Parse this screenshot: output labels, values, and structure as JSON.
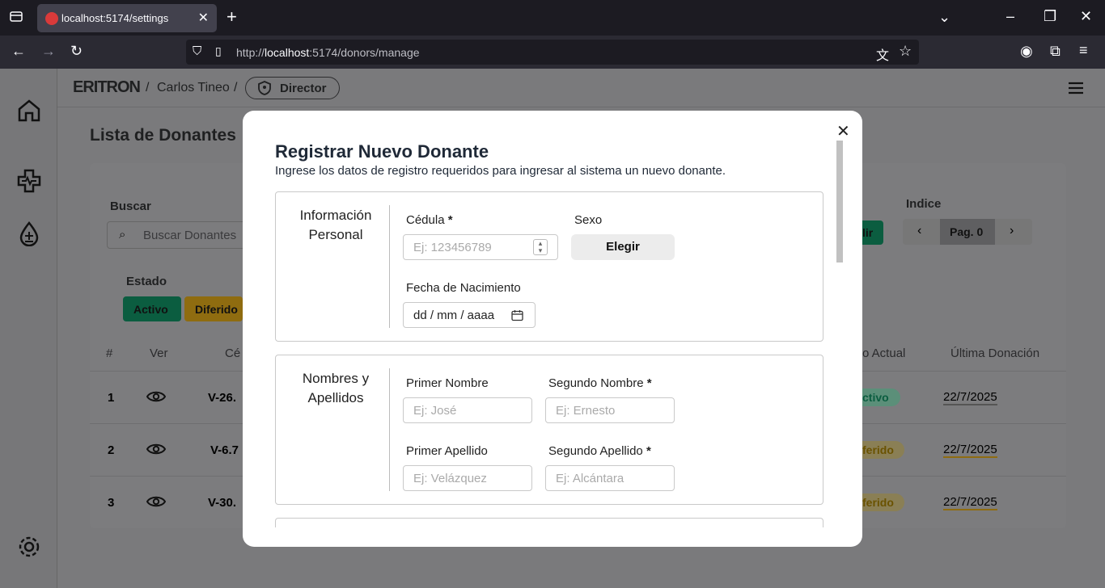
{
  "browser": {
    "tab_title": "localhost:5174/settings",
    "url_prefix": "http://",
    "url_host": "localhost",
    "url_rest": ":5174/donors/manage"
  },
  "header": {
    "logo_text": "ERITRON",
    "user_name": "Carlos Tineo",
    "separator": "/",
    "role": "Director"
  },
  "page": {
    "title": "Lista de Donantes",
    "search_label": "Buscar",
    "search_placeholder": "Buscar Donantes",
    "estado_label": "Estado",
    "status_chips": [
      "Activo",
      "Diferido"
    ],
    "indice_label": "Indice",
    "page_indicator": "Pag. 0",
    "partial_button": "lir",
    "columns": [
      "#",
      "Ver",
      "Cé",
      "o Actual",
      "Última Donación"
    ],
    "rows": [
      {
        "num": "1",
        "cedula": "V-26.",
        "status": "ctivo",
        "date": "22/7/2025"
      },
      {
        "num": "2",
        "cedula": "V-6.7",
        "status": "ferido",
        "date": "22/7/2025"
      },
      {
        "num": "3",
        "cedula": "V-30.",
        "status": "ferido",
        "date": "22/7/2025"
      }
    ]
  },
  "modal": {
    "title": "Registrar Nuevo Donante",
    "subtitle": "Ingrese los datos de registro requeridos para ingresar al sistema un nuevo donante.",
    "sections": {
      "personal": {
        "label_line1": "Información",
        "label_line2": "Personal",
        "cedula_label": "Cédula",
        "cedula_placeholder": "Ej: 123456789",
        "sexo_label": "Sexo",
        "sexo_button": "Elegir",
        "fecha_label": "Fecha de Nacimiento",
        "fecha_placeholder": "dd / mm / aaaa"
      },
      "names": {
        "label_line1": "Nombres y",
        "label_line2": "Apellidos",
        "primer_nombre_label": "Primer Nombre",
        "primer_nombre_placeholder": "Ej: José",
        "segundo_nombre_label": "Segundo Nombre",
        "segundo_nombre_placeholder": "Ej: Ernesto",
        "primer_apellido_label": "Primer Apellido",
        "primer_apellido_placeholder": "Ej: Velázquez",
        "segundo_apellido_label": "Segundo Apellido",
        "segundo_apellido_placeholder": "Ej: Alcántara"
      }
    },
    "required_mark": "*",
    "close_glyph": "✕"
  },
  "colors": {
    "activo": "#0f8a5f",
    "diferido": "#e0a800",
    "overlay": "#7a7a7c"
  }
}
